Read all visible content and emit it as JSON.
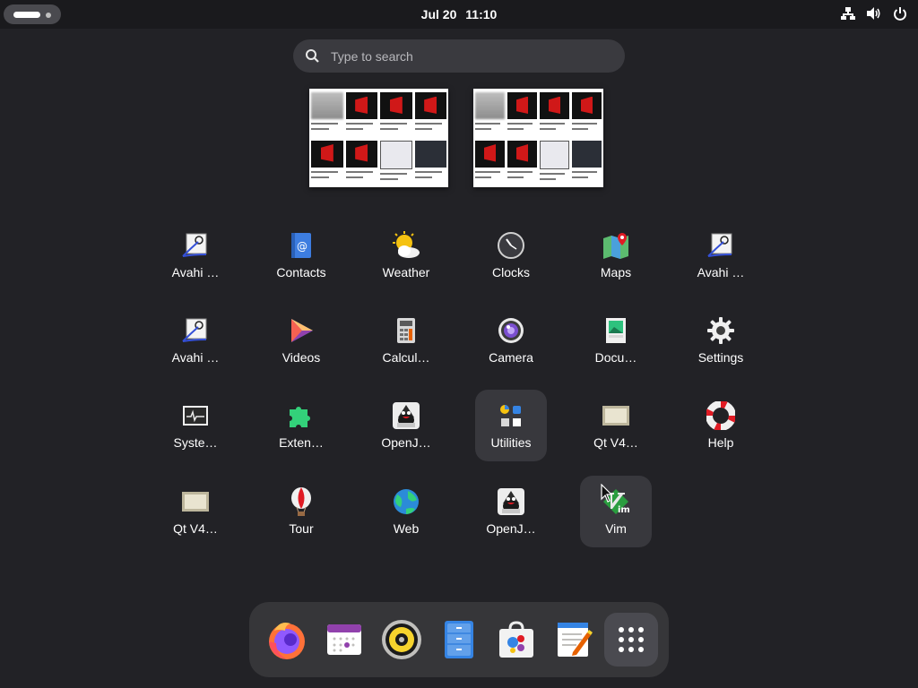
{
  "topbar": {
    "date": "Jul 20",
    "time": "11:10",
    "icons": [
      "network-wired-icon",
      "volume-icon",
      "power-icon"
    ]
  },
  "search": {
    "placeholder": "Type to search"
  },
  "apps": [
    {
      "label": "Avahi …",
      "icon": "avahi-icon"
    },
    {
      "label": "Contacts",
      "icon": "contacts-icon"
    },
    {
      "label": "Weather",
      "icon": "weather-icon"
    },
    {
      "label": "Clocks",
      "icon": "clocks-icon"
    },
    {
      "label": "Maps",
      "icon": "maps-icon"
    },
    {
      "label": "Avahi …",
      "icon": "avahi-icon"
    },
    {
      "label": "Avahi …",
      "icon": "avahi-icon"
    },
    {
      "label": "Videos",
      "icon": "videos-icon"
    },
    {
      "label": "Calcul…",
      "icon": "calculator-icon"
    },
    {
      "label": "Camera",
      "icon": "camera-icon"
    },
    {
      "label": "Docu…",
      "icon": "document-viewer-icon"
    },
    {
      "label": "Settings",
      "icon": "settings-gear-icon"
    },
    {
      "label": "Syste…",
      "icon": "system-monitor-icon"
    },
    {
      "label": "Exten…",
      "icon": "extensions-puzzle-icon"
    },
    {
      "label": "OpenJ…",
      "icon": "openjdk-icon"
    },
    {
      "label": "Utilities",
      "icon": "utilities-folder-icon"
    },
    {
      "label": "Qt V4…",
      "icon": "qt-v4l2-icon"
    },
    {
      "label": "Help",
      "icon": "help-lifebuoy-icon"
    },
    {
      "label": "Qt V4…",
      "icon": "qt-v4l2-icon"
    },
    {
      "label": "Tour",
      "icon": "tour-balloon-icon"
    },
    {
      "label": "Web",
      "icon": "web-browser-icon"
    },
    {
      "label": "OpenJ…",
      "icon": "openjdk-icon"
    },
    {
      "label": "Vim",
      "icon": "vim-icon"
    }
  ],
  "dock": [
    "firefox-icon",
    "calendar-icon",
    "rhythmbox-icon",
    "files-icon",
    "software-icon",
    "text-editor-icon",
    "show-apps-grid-icon"
  ],
  "colors": {
    "background": "#222226",
    "topbar": "#1a1a1d",
    "dock": "#363639",
    "highlight": "#38383d"
  }
}
